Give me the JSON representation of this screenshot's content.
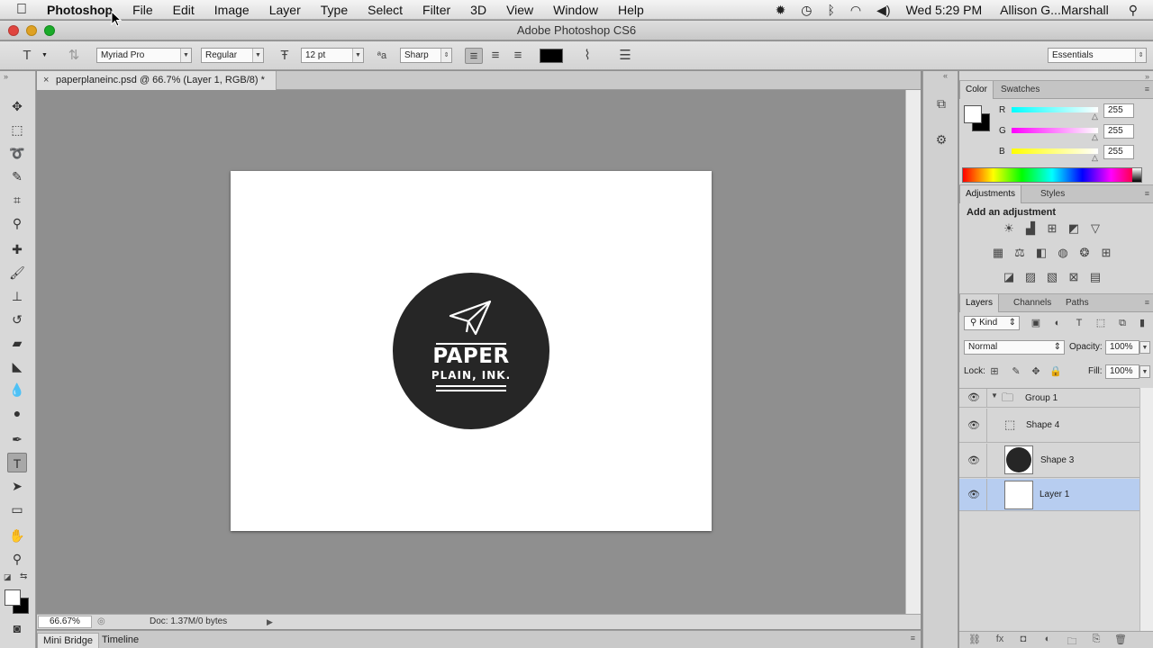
{
  "menubar": {
    "items": [
      "Photoshop",
      "File",
      "Edit",
      "Image",
      "Layer",
      "Type",
      "Select",
      "Filter",
      "3D",
      "View",
      "Window",
      "Help"
    ],
    "clock": "Wed 5:29 PM",
    "user": "Allison G...Marshall"
  },
  "window": {
    "title": "Adobe Photoshop CS6"
  },
  "options": {
    "font_family": "Myriad Pro",
    "font_style": "Regular",
    "font_size": "12 pt",
    "antialias": "Sharp",
    "text_color": "#000000",
    "workspace": "Essentials"
  },
  "document": {
    "tab_title": "paperplaneinc.psd @ 66.7% (Layer 1, RGB/8) *",
    "close_glyph": "×",
    "logo_line1": "PAPER",
    "logo_line2": "PLAIN, INK."
  },
  "status": {
    "zoom": "66.67%",
    "doc_info": "Doc: 1.37M/0 bytes"
  },
  "bottom_tabs": [
    "Mini Bridge",
    "Timeline"
  ],
  "color_panel": {
    "tabs": [
      "Color",
      "Swatches"
    ],
    "r": "255",
    "g": "255",
    "b": "255",
    "r_label": "R",
    "g_label": "G",
    "b_label": "B"
  },
  "adjustments_panel": {
    "tabs": [
      "Adjustments",
      "Styles"
    ],
    "title": "Add an adjustment"
  },
  "layers_panel": {
    "tabs": [
      "Layers",
      "Channels",
      "Paths"
    ],
    "kind": "Kind",
    "blend_mode": "Normal",
    "opacity_label": "Opacity:",
    "opacity": "100%",
    "lock_label": "Lock:",
    "fill_label": "Fill:",
    "fill": "100%",
    "layers": [
      {
        "name": "Group 1"
      },
      {
        "name": "Shape 4"
      },
      {
        "name": "Shape 3"
      },
      {
        "name": "Layer 1"
      }
    ]
  },
  "colors": {
    "accent_selection": "#b7cdf0",
    "logo_dark": "#262626"
  }
}
